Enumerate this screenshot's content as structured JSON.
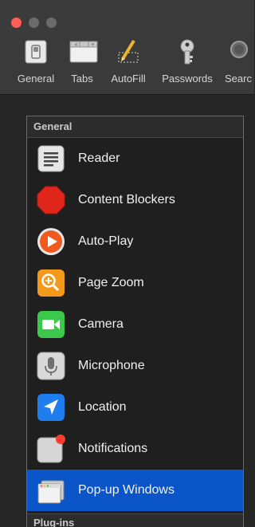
{
  "window": {
    "traffic_lights": {
      "close": "#ff5f57",
      "minimize": "#6b6b6b",
      "zoom": "#6b6b6b"
    }
  },
  "toolbar": {
    "items": [
      {
        "label": "General",
        "icon": "general-switch-icon"
      },
      {
        "label": "Tabs",
        "icon": "tabs-icon"
      },
      {
        "label": "AutoFill",
        "icon": "autofill-pencil-icon"
      },
      {
        "label": "Passwords",
        "icon": "key-icon"
      },
      {
        "label": "Searc",
        "icon": "search-icon"
      }
    ]
  },
  "sidebar": {
    "section_general": "General",
    "items": [
      {
        "label": "Reader",
        "icon": "reader-icon"
      },
      {
        "label": "Content Blockers",
        "icon": "stop-sign-icon"
      },
      {
        "label": "Auto-Play",
        "icon": "play-icon"
      },
      {
        "label": "Page Zoom",
        "icon": "zoom-icon"
      },
      {
        "label": "Camera",
        "icon": "camera-icon"
      },
      {
        "label": "Microphone",
        "icon": "microphone-icon"
      },
      {
        "label": "Location",
        "icon": "location-arrow-icon"
      },
      {
        "label": "Notifications",
        "icon": "notification-badge-icon"
      },
      {
        "label": "Pop-up Windows",
        "icon": "popup-windows-icon",
        "selected": true
      }
    ],
    "section_plugins": "Plug-ins"
  },
  "colors": {
    "selection": "#0a56c8",
    "background": "#1f1f1f"
  }
}
